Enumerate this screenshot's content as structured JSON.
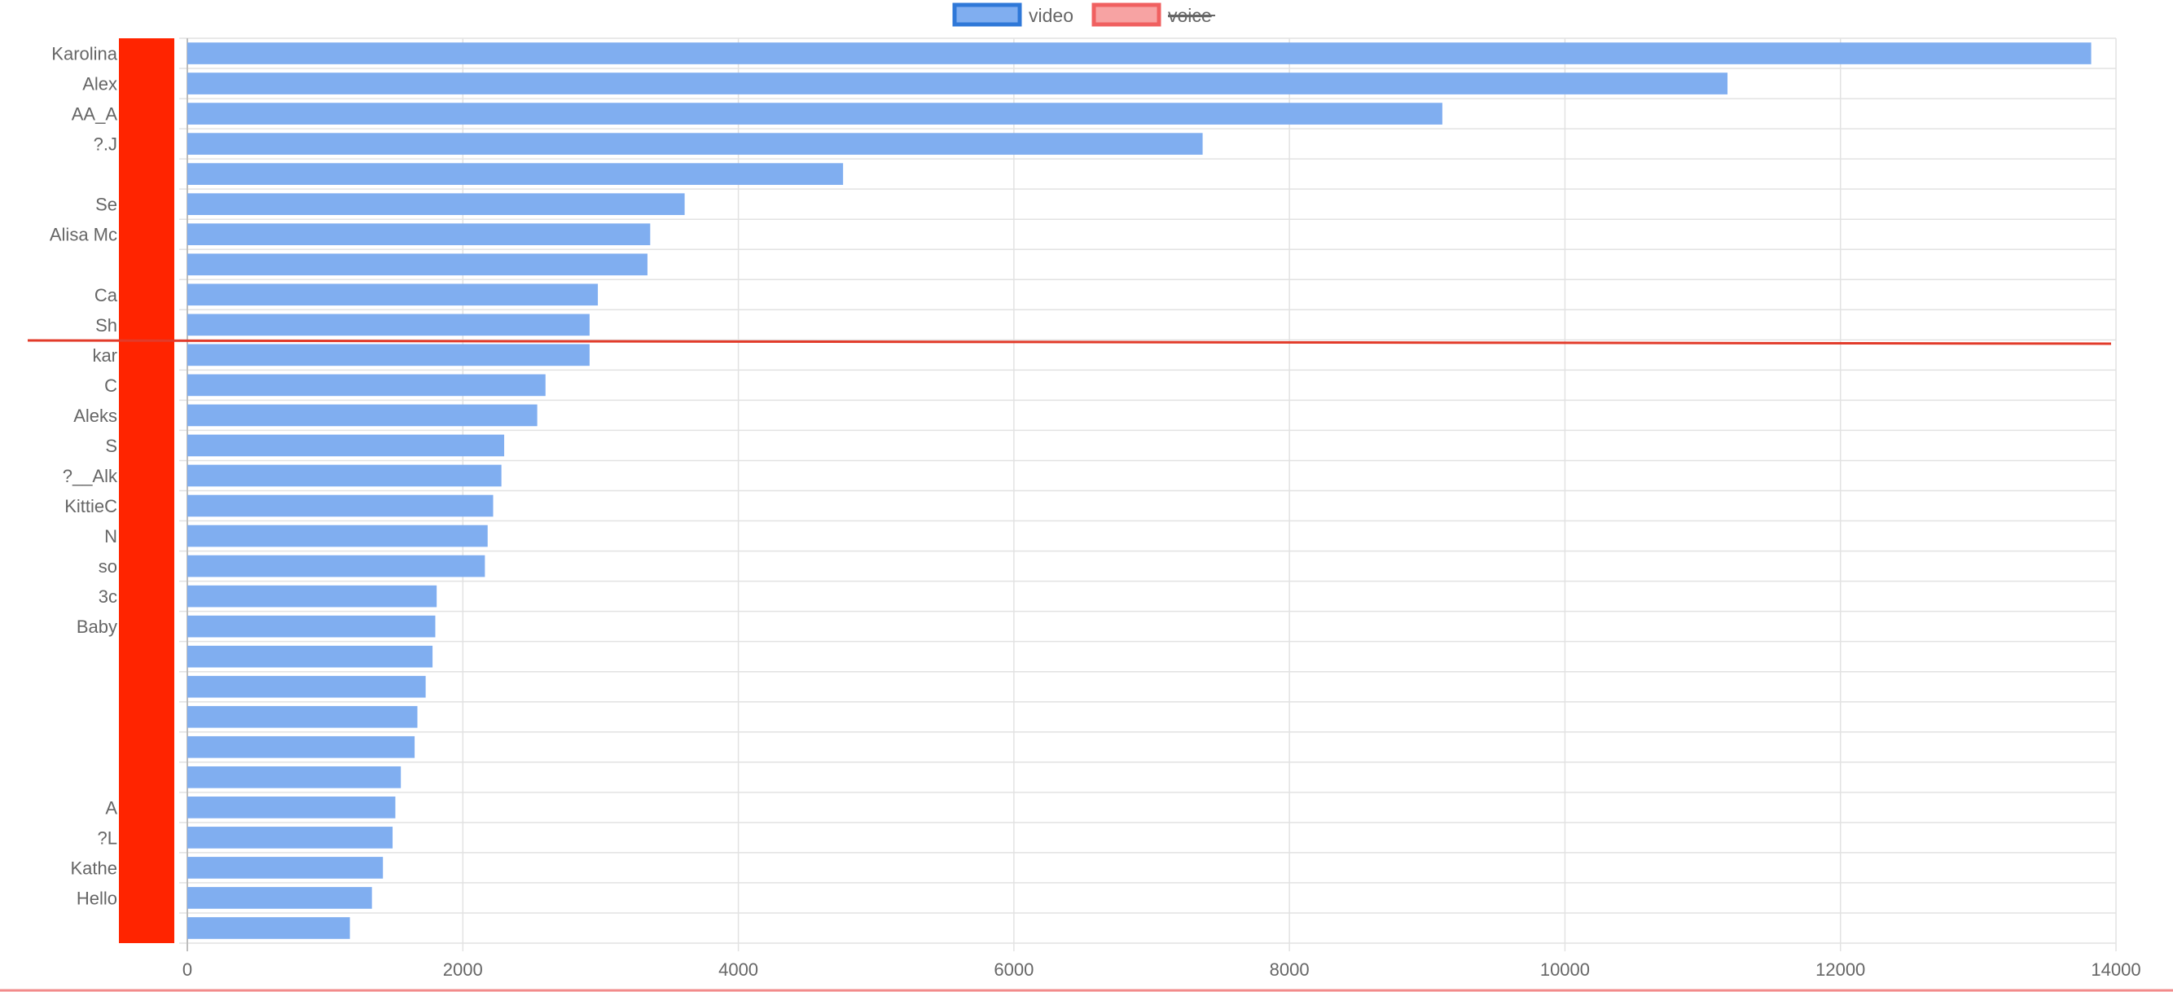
{
  "chart_data": {
    "type": "bar",
    "orientation": "horizontal",
    "categories": [
      "Karolina",
      "Alex",
      "AA_A",
      "?.J",
      "",
      "Se",
      "Alisa Mc",
      "",
      "Ca",
      "Sh",
      "kar",
      "C",
      "Aleks",
      "S",
      "?__Alk",
      "KittieC",
      "N",
      "so",
      "3c",
      "Baby",
      "",
      "",
      "",
      "",
      "",
      "A",
      "?L",
      "Kathe",
      "Hello",
      ""
    ],
    "series": [
      {
        "name": "video",
        "values": [
          13820,
          11180,
          9110,
          7370,
          4760,
          3610,
          3360,
          3340,
          2980,
          2920,
          2920,
          2600,
          2540,
          2300,
          2280,
          2220,
          2180,
          2160,
          1810,
          1800,
          1780,
          1730,
          1670,
          1650,
          1550,
          1510,
          1490,
          1420,
          1340,
          1180
        ],
        "color": "#80aef0"
      },
      {
        "name": "voice",
        "values": [],
        "hidden": true,
        "color": "#f7a3a3"
      }
    ],
    "xlim": [
      0,
      14000
    ],
    "xticks": [
      "0",
      "2000",
      "4000",
      "6000",
      "8000",
      "10000",
      "12000",
      "14000"
    ],
    "grid": true,
    "legend": "top-center"
  },
  "legend": {
    "video_label": "video",
    "voice_label": "voice"
  },
  "colors": {
    "video_fill": "#80aef0",
    "video_border": "#2f78d8",
    "voice_fill": "#f7a3a3",
    "voice_border": "#f06060",
    "redaction": "#ff2400",
    "grid": "#e2e2e2"
  }
}
